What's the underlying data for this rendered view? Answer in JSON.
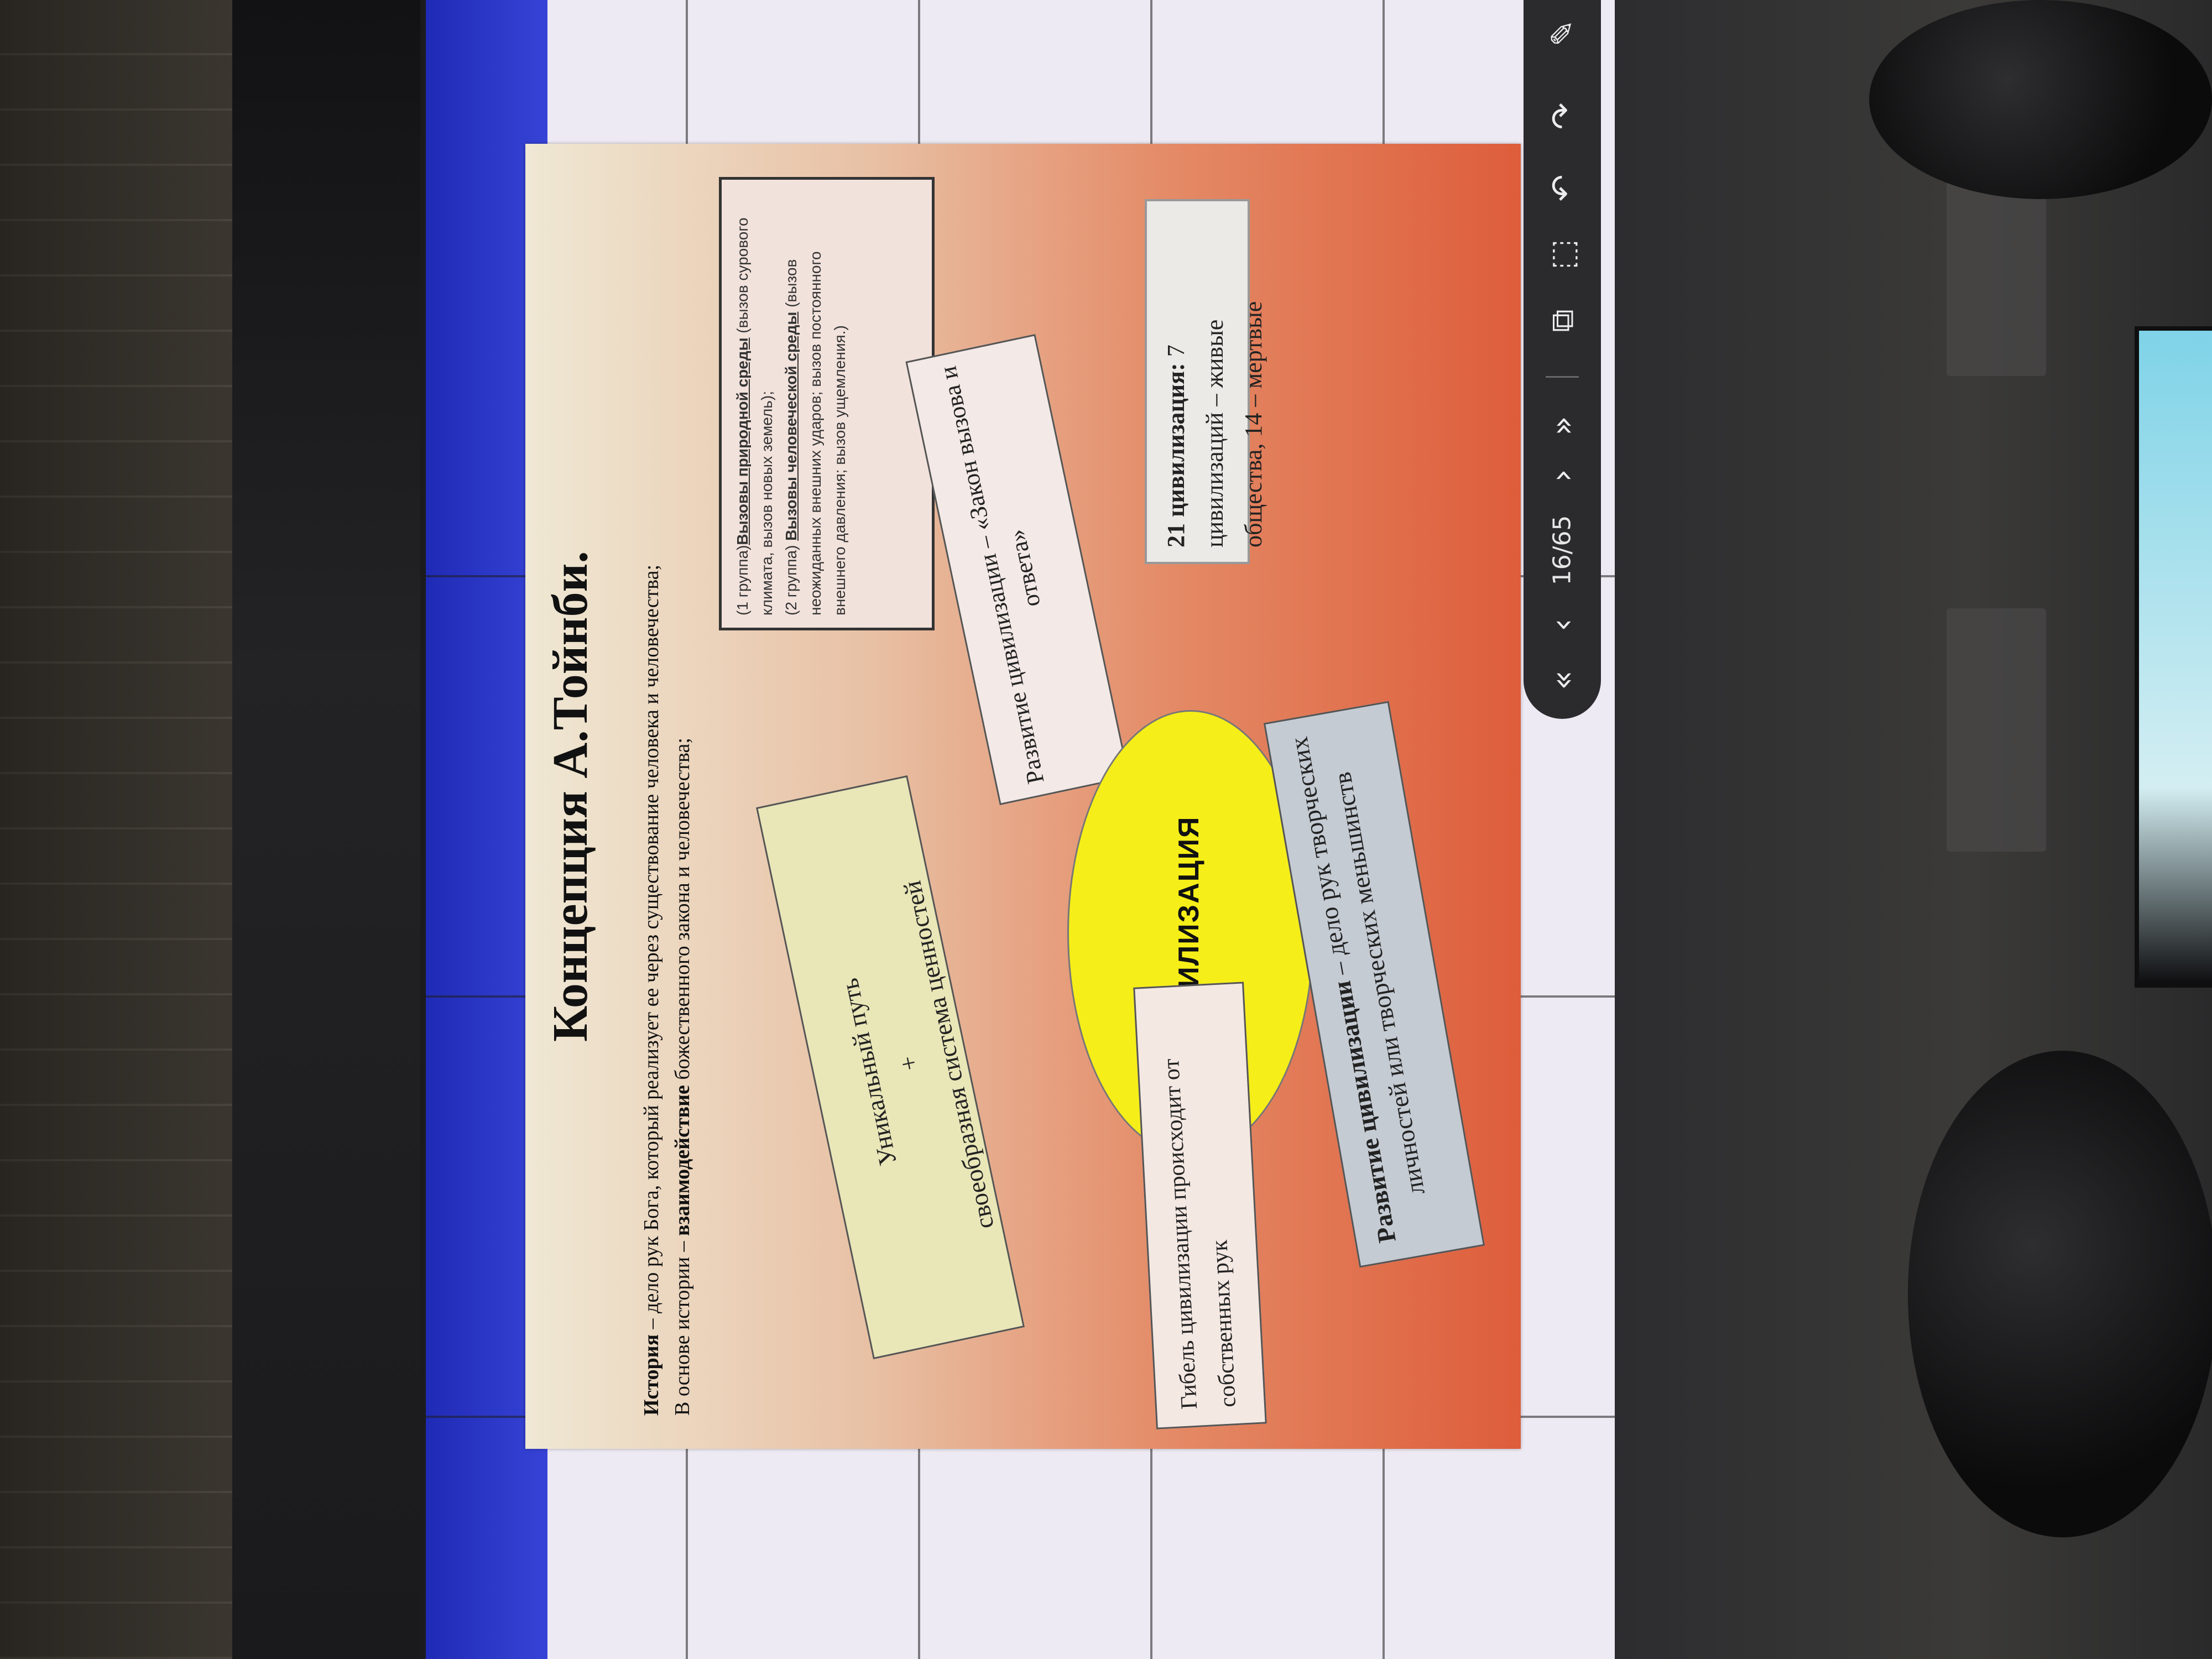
{
  "slide": {
    "title": "Концепция  А.Тойнби.",
    "def_history_term": "История",
    "def_history_text": " – дело рук Бога, который реализует ее через существование человека и человечества;",
    "def_basis_prefix": "В основе истории – ",
    "def_basis_term": "взаимодействие",
    "def_basis_text": " божественного закона и человечества;",
    "challenges": {
      "g1_prefix": "(1 группа)",
      "g1_term": "Вызовы природной среды",
      "g1_text": " (вызов сурового климата, вызов новых земель);",
      "g2_prefix": "(2 группа) ",
      "g2_term": "Вызовы человеческой среды",
      "g2_text": " (вызов неожиданных внешних ударов; вызов постоянного внешнего давления; вызов ущемления.)"
    },
    "law_box": "Развитие цивилизации – «Закон вызова и ответа»",
    "unique_line1": "Уникальный путь",
    "unique_plus": "+",
    "unique_line2": "своеобразная система ценностей",
    "civ_label": "ЦИВИЛИЗАЦИЯ",
    "count_term": "21 цивилизация:",
    "count_text": " 7 цивилизаций – живые общества, 14 – мертвые",
    "death_text": "Гибель цивилизации происходит от собственных рук",
    "dev_term": "Развитие цивилизации",
    "dev_text": " – дело рук творческих личностей или творческих меньшинств"
  },
  "toolbar": {
    "page_counter": "16/65",
    "icons": [
      "first-page-icon",
      "prev-page-icon",
      "next-page-icon",
      "last-page-icon",
      "select-icon",
      "crop-icon",
      "undo-icon",
      "redo-icon",
      "pen-icon"
    ]
  }
}
